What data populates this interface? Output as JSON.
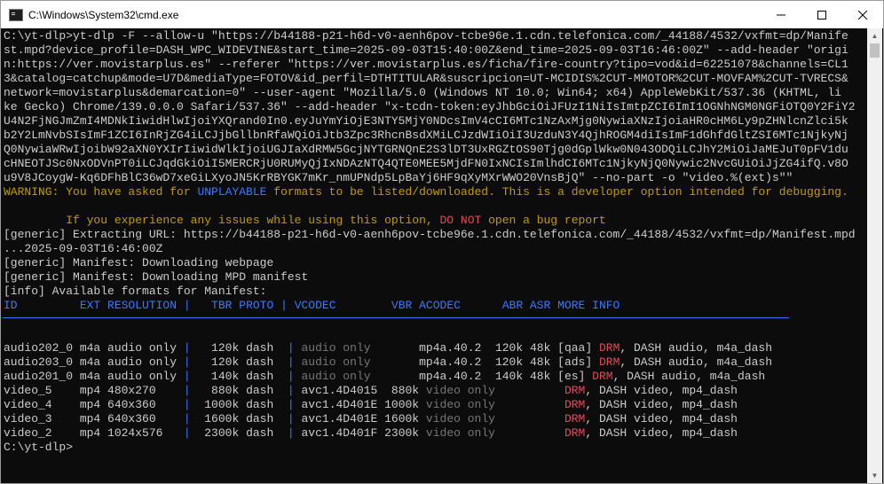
{
  "window": {
    "title": "C:\\Windows\\System32\\cmd.exe"
  },
  "controls": {
    "minimize_icon": "minimize-icon",
    "maximize_icon": "maximize-icon",
    "close_icon": "close-icon"
  },
  "console": {
    "lines": [
      "C:\\yt-dlp>yt-dlp -F --allow-u \"https://b44188-p21-h6d-v0-aenh6pov-tcbe96e.1.cdn.telefonica.com/_44188/4532/vxfmt=dp/Manife",
      "st.mpd?device_profile=DASH_WPC_WIDEVINE&start_time=2025-09-03T15:40:00Z&end_time=2025-09-03T16:46:00Z\" --add-header \"origi",
      "n:https://ver.movistarplus.es\" --referer \"https://ver.movistarplus.es/ficha/fire-country?tipo=vod&id=62251078&channels=CL1",
      "3&catalog=catchup&mode=U7D&mediaType=FOTOV&id_perfil=DTHTITULAR&suscripcion=UT-MCIDIS%2CUT-MMOTOR%2CUT-MOVFAM%2CUT-TVRECS&",
      "network=movistarplus&demarcation=0\" --user-agent \"Mozilla/5.0 (Windows NT 10.0; Win64; x64) AppleWebKit/537.36 (KHTML, li",
      "ke Gecko) Chrome/139.0.0.0 Safari/537.36\" --add-header \"x-tcdn-token:eyJhbGciOiJFUzI1NiIsImtpZCI6ImI1OGNhNGM0NGFiOTQ0Y2FiY2",
      "U4N2FjNGJmZmI4MDNkIiwidHlwIjoiYXQrand0In0.eyJuYmYiOjE3NTY5MjY0NDcsImV4cCI6MTc1NzAxMjg0NywiaXNzIjoiaHR0cHM6Ly9pZHNlcnZlci5k",
      "b2Y2LmNvbSIsImF1ZCI6InRjZG4iLCJjbGllbnRfaWQiOiJtb3Zpc3RhcnBsdXMiLCJzdWIiOiI3UzduN3Y4QjhROGM4diIsImF1dGhfdGltZSI6MTc1NjkyNj",
      "Q0NywiaWRwIjoibW92aXN0YXIrIiwidWlkIjoiUGJIaXdRMW5GcjNYTGRNQnE2S3lDT3UxRGZtOS90Tjg0dGplWkw0N043ODQiLCJhY2MiOiJaMEJuT0pFV1du",
      "cHNEOTJSc0NxODVnPT0iLCJqdGkiOiI5MERCRjU0RUMyQjIxNDAzNTQ4QTE0MEE5MjdFN0IxNCIsImlhdCI6MTc1NjkyNjQ0Nywic2NvcGUiOiJjZG4ifQ.v8O",
      "u9V8JCoygW-Kq6DFhBlC36wD7xeGiLXyoJN5KrRBYGK7mKr_nmUPNdp5LpBaYj6HF9qXyMXrWWO20VnsBjQ\" --no-part -o \"video.%(ext)s\"\"",
      "",
      "",
      "",
      "[generic] Extracting URL: https://b44188-p21-h6d-v0-aenh6pov-tcbe96e.1.cdn.telefonica.com/_44188/4532/vxfmt=dp/Manifest.mpd",
      "...2025-09-03T16:46:00Z",
      "[generic] Manifest: Downloading webpage",
      "[generic] Manifest: Downloading MPD manifest",
      "[info] Available formats for Manifest:",
      "",
      "",
      "",
      "",
      "",
      "",
      "",
      "",
      "",
      "",
      "",
      "C:\\yt-dlp>"
    ],
    "warning": {
      "prefix": "WARNING:",
      "text1": " You have asked for ",
      "unplayable": "UNPLAYABLE",
      "text2": " formats to be listed/downloaded. This is a developer option intended for debugging."
    },
    "notice": {
      "text1": "         If you experience any issues while using this option, ",
      "donot": "DO NOT",
      "text2": " open a bug report"
    },
    "table": {
      "header": {
        "id": "ID         EXT RESOLUTION ",
        "pipe1": "|",
        "tbr": "   TBR PROTO ",
        "pipe2": "|",
        "codecs": " VCODEC        VBR ACODEC      ABR ASR MORE INFO"
      },
      "rows": [
        {
          "id": "audio202_0",
          "ext": "m4a",
          "res": "audio only",
          "tbr": "120k",
          "proto": "dash",
          "vcodec": "audio only",
          "vbr": "",
          "acodec": "mp4a.40.2",
          "abr": "120k",
          "asr": "48k",
          "lang": "[qaa]",
          "drm": "DRM",
          "info": ", DASH audio, m4a_dash"
        },
        {
          "id": "audio203_0",
          "ext": "m4a",
          "res": "audio only",
          "tbr": "120k",
          "proto": "dash",
          "vcodec": "audio only",
          "vbr": "",
          "acodec": "mp4a.40.2",
          "abr": "120k",
          "asr": "48k",
          "lang": "[ads]",
          "drm": "DRM",
          "info": ", DASH audio, m4a_dash"
        },
        {
          "id": "audio201_0",
          "ext": "m4a",
          "res": "audio only",
          "tbr": "140k",
          "proto": "dash",
          "vcodec": "audio only",
          "vbr": "",
          "acodec": "mp4a.40.2",
          "abr": "140k",
          "asr": "48k",
          "lang": "[es]",
          "drm": "DRM",
          "info": ", DASH audio, m4a_dash"
        },
        {
          "id": "video_5",
          "ext": "mp4",
          "res": "480x270",
          "tbr": "880k",
          "proto": "dash",
          "vcodec": "avc1.4D4015",
          "vbr": "880k",
          "acodec": "video only",
          "abr": "",
          "asr": "",
          "lang": "",
          "drm": "DRM",
          "info": ", DASH video, mp4_dash"
        },
        {
          "id": "video_4",
          "ext": "mp4",
          "res": "640x360",
          "tbr": "1000k",
          "proto": "dash",
          "vcodec": "avc1.4D401E",
          "vbr": "1000k",
          "acodec": "video only",
          "abr": "",
          "asr": "",
          "lang": "",
          "drm": "DRM",
          "info": ", DASH video, mp4_dash"
        },
        {
          "id": "video_3",
          "ext": "mp4",
          "res": "640x360",
          "tbr": "1600k",
          "proto": "dash",
          "vcodec": "avc1.4D401E",
          "vbr": "1600k",
          "acodec": "video only",
          "abr": "",
          "asr": "",
          "lang": "",
          "drm": "DRM",
          "info": ", DASH video, mp4_dash"
        },
        {
          "id": "video_2",
          "ext": "mp4",
          "res": "1024x576",
          "tbr": "2300k",
          "proto": "dash",
          "vcodec": "avc1.4D401F",
          "vbr": "2300k",
          "acodec": "video only",
          "abr": "",
          "asr": "",
          "lang": "",
          "drm": "DRM",
          "info": ", DASH video, mp4_dash"
        }
      ]
    }
  },
  "colors": {
    "background": "#0c0c0c",
    "text": "#cccccc",
    "warning": "#c19c00",
    "blue": "#3b78ff",
    "red": "#e74856",
    "gray": "#767676"
  }
}
